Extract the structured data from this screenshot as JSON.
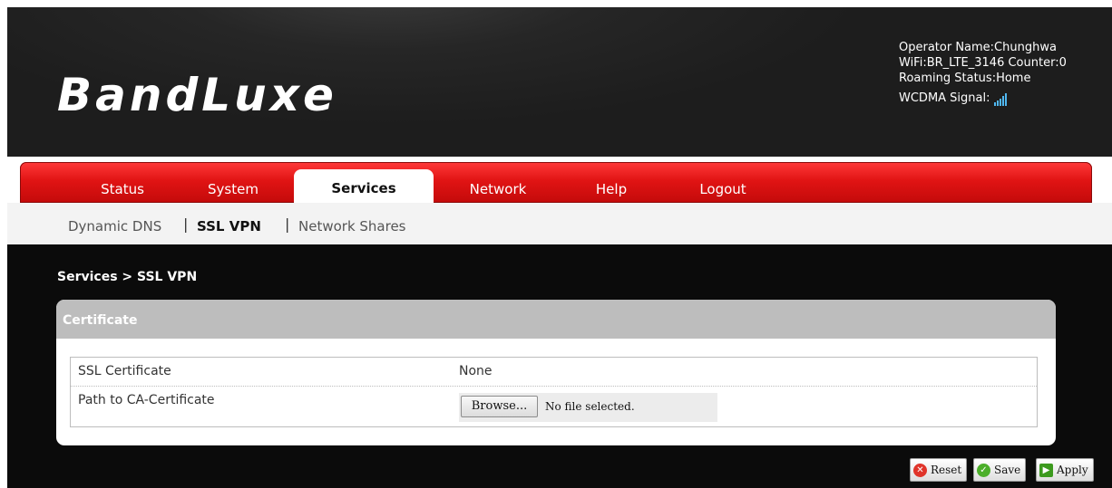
{
  "header": {
    "logo_text": "BandLuxe",
    "operator": "Operator Name:Chunghwa",
    "wifi": "WiFi:BR_LTE_3146 Counter:0",
    "roaming": "Roaming Status:Home",
    "signal_label": "WCDMA Signal:"
  },
  "nav": {
    "tabs": [
      {
        "label": "Status"
      },
      {
        "label": "System"
      },
      {
        "label": "Services"
      },
      {
        "label": "Network"
      },
      {
        "label": "Help"
      },
      {
        "label": "Logout"
      }
    ],
    "active": "Services"
  },
  "subnav": {
    "items": [
      {
        "label": "Dynamic DNS"
      },
      {
        "label": "SSL VPN"
      },
      {
        "label": "Network Shares"
      }
    ],
    "separator": "|"
  },
  "breadcrumb": "Services > SSL VPN",
  "panel": {
    "title": "Certificate",
    "rows": [
      {
        "label": "SSL Certificate",
        "value": "None"
      },
      {
        "label": "Path to CA-Certificate",
        "browse_label": "Browse...",
        "file_status": "No file selected."
      }
    ]
  },
  "actions": {
    "reset": "Reset",
    "save": "Save",
    "apply": "Apply"
  },
  "colors": {
    "nav_red": "#e11414",
    "signal_blue": "#4fb7f0",
    "panel_head": "#bdbdbd"
  }
}
